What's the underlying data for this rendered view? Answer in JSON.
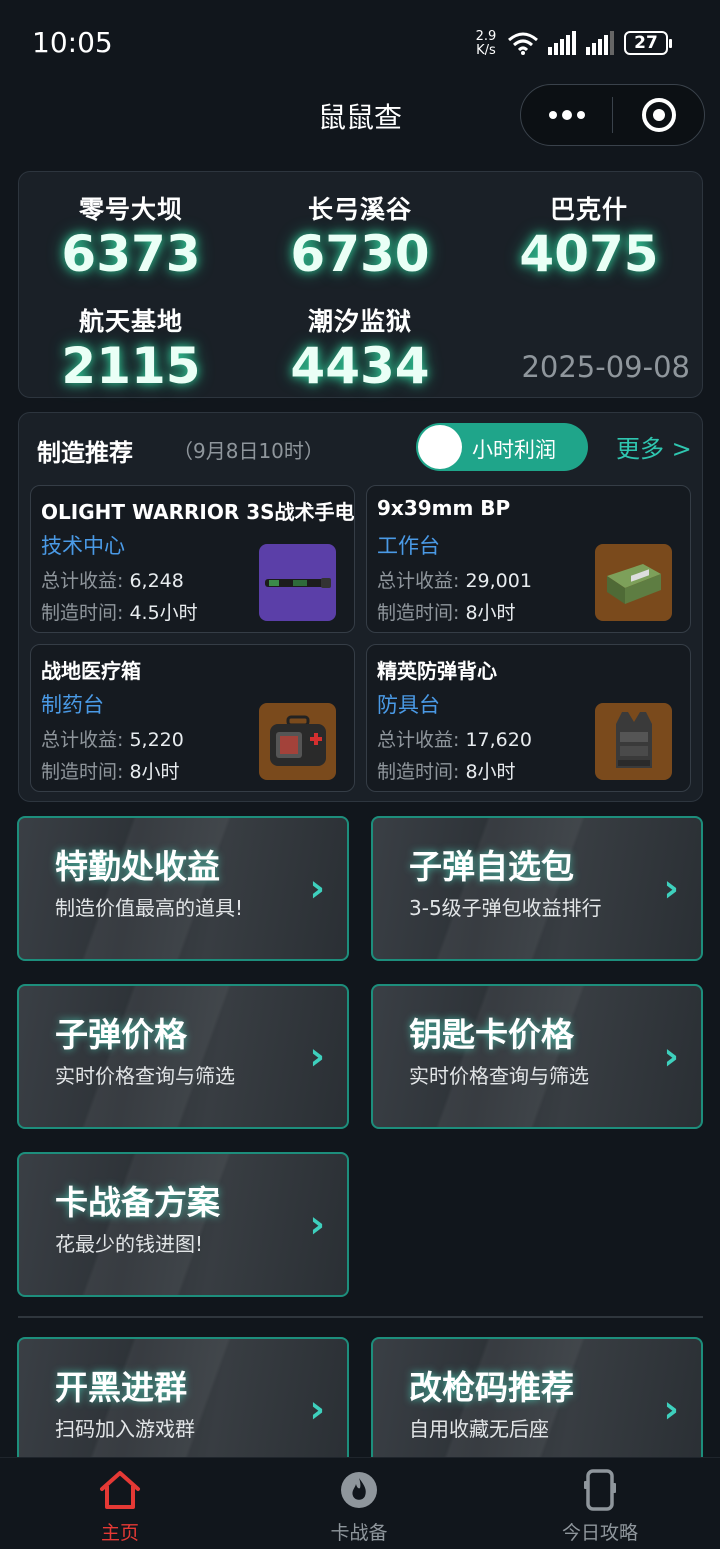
{
  "status_bar": {
    "time": "10:05",
    "net_speed_value": "2.9",
    "net_speed_unit": "K/s",
    "battery": "27"
  },
  "header": {
    "title": "鼠鼠查",
    "more_icon": "more-dots-icon",
    "close_icon": "target-circle-icon"
  },
  "stats": {
    "items": [
      {
        "name": "零号大坝",
        "value": "6373"
      },
      {
        "name": "长弓溪谷",
        "value": "6730"
      },
      {
        "name": "巴克什",
        "value": "4075"
      },
      {
        "name": "航天基地",
        "value": "2115"
      },
      {
        "name": "潮汐监狱",
        "value": "4434"
      }
    ],
    "date": "2025-09-08",
    "glow_color": "#34e6aa"
  },
  "craft": {
    "title": "制造推荐",
    "subtitle": "（9月8日10时）",
    "toggle_label": "小时利润",
    "more_label": "更多 >",
    "profit_label": "总计收益:",
    "time_label": "制造时间:",
    "items": [
      {
        "name": "OLIGHT WARRIOR 3S战术手电",
        "station": "技术中心",
        "profit": "6,248",
        "time": "4.5小时",
        "icon": "flashlight-icon",
        "bg": "#5b3fa8"
      },
      {
        "name": "9x39mm BP",
        "station": "工作台",
        "profit": "29,001",
        "time": "8小时",
        "icon": "ammo-box-icon",
        "bg": "#7a4a1c"
      },
      {
        "name": "战地医疗箱",
        "station": "制药台",
        "profit": "5,220",
        "time": "8小时",
        "icon": "medkit-icon",
        "bg": "#7a4a1c"
      },
      {
        "name": "精英防弹背心",
        "station": "防具台",
        "profit": "17,620",
        "time": "8小时",
        "icon": "vest-icon",
        "bg": "#7a4a1c"
      }
    ]
  },
  "features": [
    {
      "title": "特勤处收益",
      "desc": "制造价值最高的道具!"
    },
    {
      "title": "子弹自选包",
      "desc": "3-5级子弹包收益排行"
    },
    {
      "title": "子弹价格",
      "desc": "实时价格查询与筛选"
    },
    {
      "title": "钥匙卡价格",
      "desc": "实时价格查询与筛选"
    },
    {
      "title": "卡战备方案",
      "desc": "花最少的钱进图!"
    },
    {
      "title": "开黑进群",
      "desc": "扫码加入游戏群"
    },
    {
      "title": "改枪码推荐",
      "desc": "自用收藏无后座"
    }
  ],
  "feature_arrow": "›",
  "tabs": [
    {
      "label": "主页",
      "icon": "home-icon",
      "active": true
    },
    {
      "label": "卡战备",
      "icon": "flame-icon",
      "active": false
    },
    {
      "label": "今日攻略",
      "icon": "phone-icon",
      "active": false
    }
  ],
  "colors": {
    "accent": "#1fa58a",
    "link": "#2fc6b0",
    "station": "#4a9ae6",
    "active_tab": "#e53935"
  }
}
